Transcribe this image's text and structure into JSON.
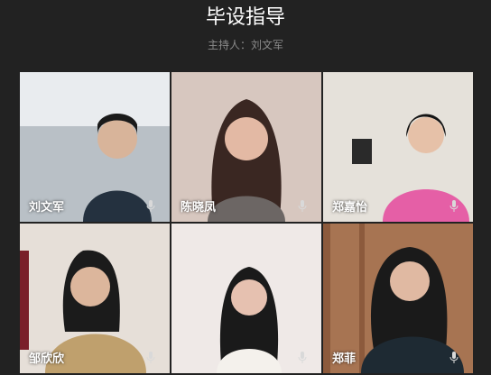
{
  "meeting": {
    "title": "毕设指导",
    "host": "主持人：刘文军"
  },
  "participants": [
    {
      "name": "刘文军",
      "mic_icon": "mic-icon",
      "bg": "#b9c0c6",
      "skin": "#d8b49a",
      "hair": "#1a1a1a",
      "shirt": "#24313f"
    },
    {
      "name": "陈晓凤",
      "mic_icon": "mic-icon",
      "bg": "#d7c7bf",
      "skin": "#e3b9a4",
      "hair": "#3a2722",
      "shirt": "#6c6664"
    },
    {
      "name": "郑嘉怡",
      "mic_icon": "mic-icon",
      "bg": "#e5e1da",
      "skin": "#e6c1a8",
      "hair": "#141414",
      "shirt": "#e55fa6"
    },
    {
      "name": "邹欣欣",
      "mic_icon": "mic-icon",
      "bg": "#e6dfd8",
      "skin": "#dcb69c",
      "hair": "#1b1b1b",
      "shirt": "#bfa06d"
    },
    {
      "name": "",
      "mic_icon": "mic-icon",
      "bg": "#efe9e7",
      "skin": "#e6c1b0",
      "hair": "#1a1a1a",
      "shirt": "#f4f1ec"
    },
    {
      "name": "郑菲",
      "mic_icon": "mic-icon",
      "bg": "#a77452",
      "skin": "#e0b9a2",
      "hair": "#1a1a1a",
      "shirt": "#1e2a33"
    }
  ]
}
